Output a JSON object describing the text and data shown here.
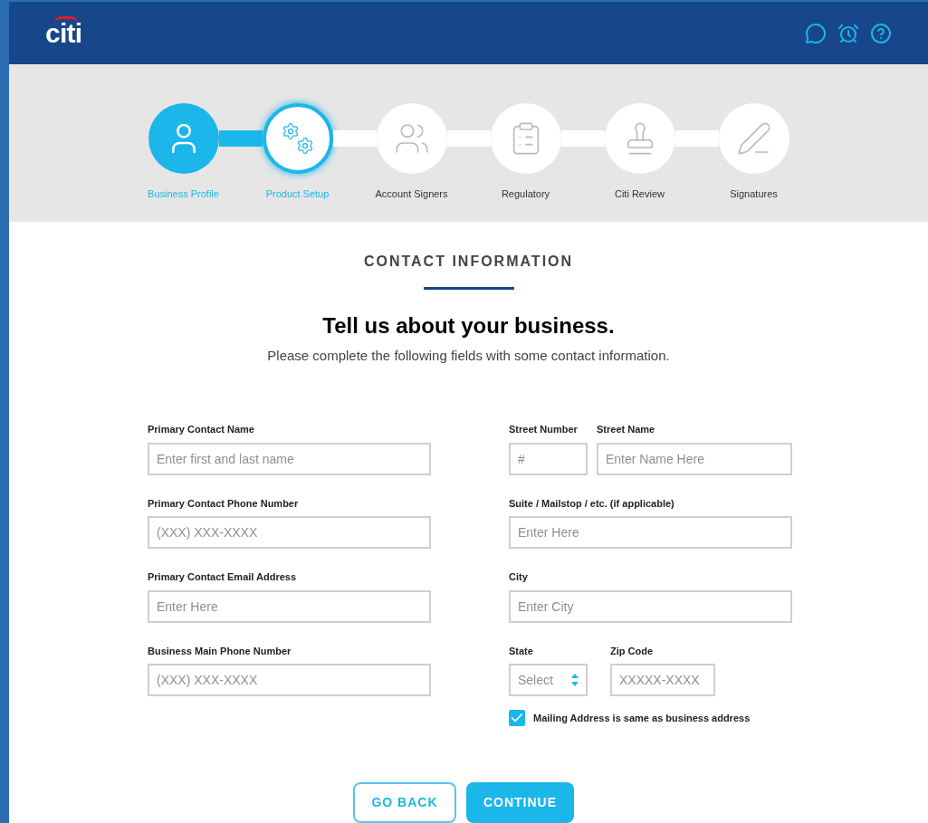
{
  "header": {
    "logo": "citi"
  },
  "steps": [
    {
      "label": "Business Profile",
      "completed": true,
      "selected": false
    },
    {
      "label": "Product Setup",
      "completed": false,
      "selected": true
    },
    {
      "label": "Account Signers",
      "completed": false,
      "selected": false
    },
    {
      "label": "Regulatory",
      "completed": false,
      "selected": false
    },
    {
      "label": "Citi Review",
      "completed": false,
      "selected": false
    },
    {
      "label": "Signatures",
      "completed": false,
      "selected": false
    }
  ],
  "section_title": "CONTACT INFORMATION",
  "heading": "Tell us about your business.",
  "subtitle": "Please complete the following fields with some contact information.",
  "left_fields": [
    {
      "label": "Primary Contact Name",
      "placeholder": "Enter first and last name"
    },
    {
      "label": "Primary Contact Phone Number",
      "placeholder": "(XXX) XXX-XXXX"
    },
    {
      "label": "Primary Contact Email Address",
      "placeholder": "Enter Here"
    },
    {
      "label": "Business Main Phone Number",
      "placeholder": "(XXX) XXX-XXXX"
    }
  ],
  "right_rows": [
    [
      {
        "label": "Street Number",
        "placeholder": "#",
        "kind": "short"
      },
      {
        "label": "Street Name",
        "placeholder": "Enter Name Here",
        "kind": "input"
      }
    ],
    [
      {
        "label": "Suite / Mailstop / etc. (if applicable)",
        "placeholder": "Enter Here",
        "kind": "input"
      }
    ],
    [
      {
        "label": "City",
        "placeholder": "Enter City",
        "kind": "input"
      }
    ],
    [
      {
        "label": "State",
        "placeholder": "Select",
        "kind": "select"
      },
      {
        "label": "Zip Code",
        "placeholder": "XXXXX-XXXX",
        "kind": "zip"
      }
    ]
  ],
  "mailing_same": {
    "label": "Mailing Address is same as business address",
    "checked": true
  },
  "buttons": [
    {
      "label": "GO BACK",
      "kind": "secondary"
    },
    {
      "label": "CONTINUE",
      "kind": "primary"
    }
  ]
}
